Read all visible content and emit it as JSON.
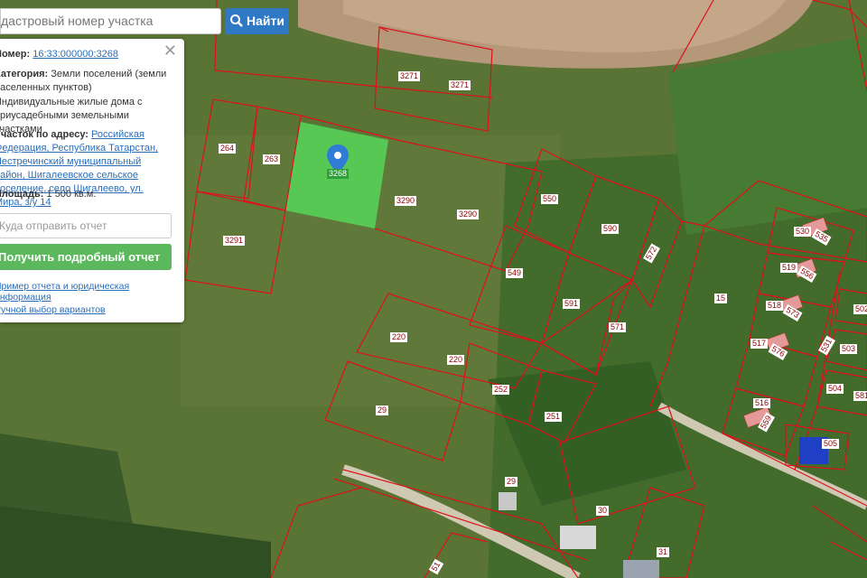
{
  "search": {
    "placeholder": "Кадастровый номер участка",
    "visible_text": "дастровый номер участка",
    "button_label": "Найти"
  },
  "info_panel": {
    "number_label": "Номер:",
    "number_value": "16:33:000000:3268",
    "category_label": "Категория:",
    "category_value": "Земли поселений (земли населенных пунктов)",
    "use_value": "Индивидуальные жилые дома с приусадебными земельными участками",
    "address_label": "Участок по адресу:",
    "address_value": "Российская Федерация, Республика Татарстан, Пестречинский муниципальный район, Шигалеевское сельское поселение, село Шигалеево, ул. Мира, з/у 14",
    "area_label": "Площадь:",
    "area_value": "1 500 кв.м.",
    "email_placeholder": "Куда отправить отчет",
    "report_button": "Получить подробный отчет",
    "link_sample": "Пример отчета и юридическая информация",
    "link_manual": "Ручной выбор вариантов"
  },
  "marker_label": "3268",
  "parcels": [
    "3271",
    "3271",
    "264",
    "263",
    "3290",
    "3290",
    "3291",
    "550",
    "590",
    "572",
    "549",
    "591",
    "571",
    "15",
    "220",
    "220",
    "252",
    "251",
    "29",
    "29",
    "30",
    "31",
    "51",
    "530",
    "535",
    "519",
    "556",
    "518",
    "573",
    "517",
    "576",
    "531",
    "502",
    "503",
    "504",
    "581",
    "516",
    "559",
    "505"
  ]
}
